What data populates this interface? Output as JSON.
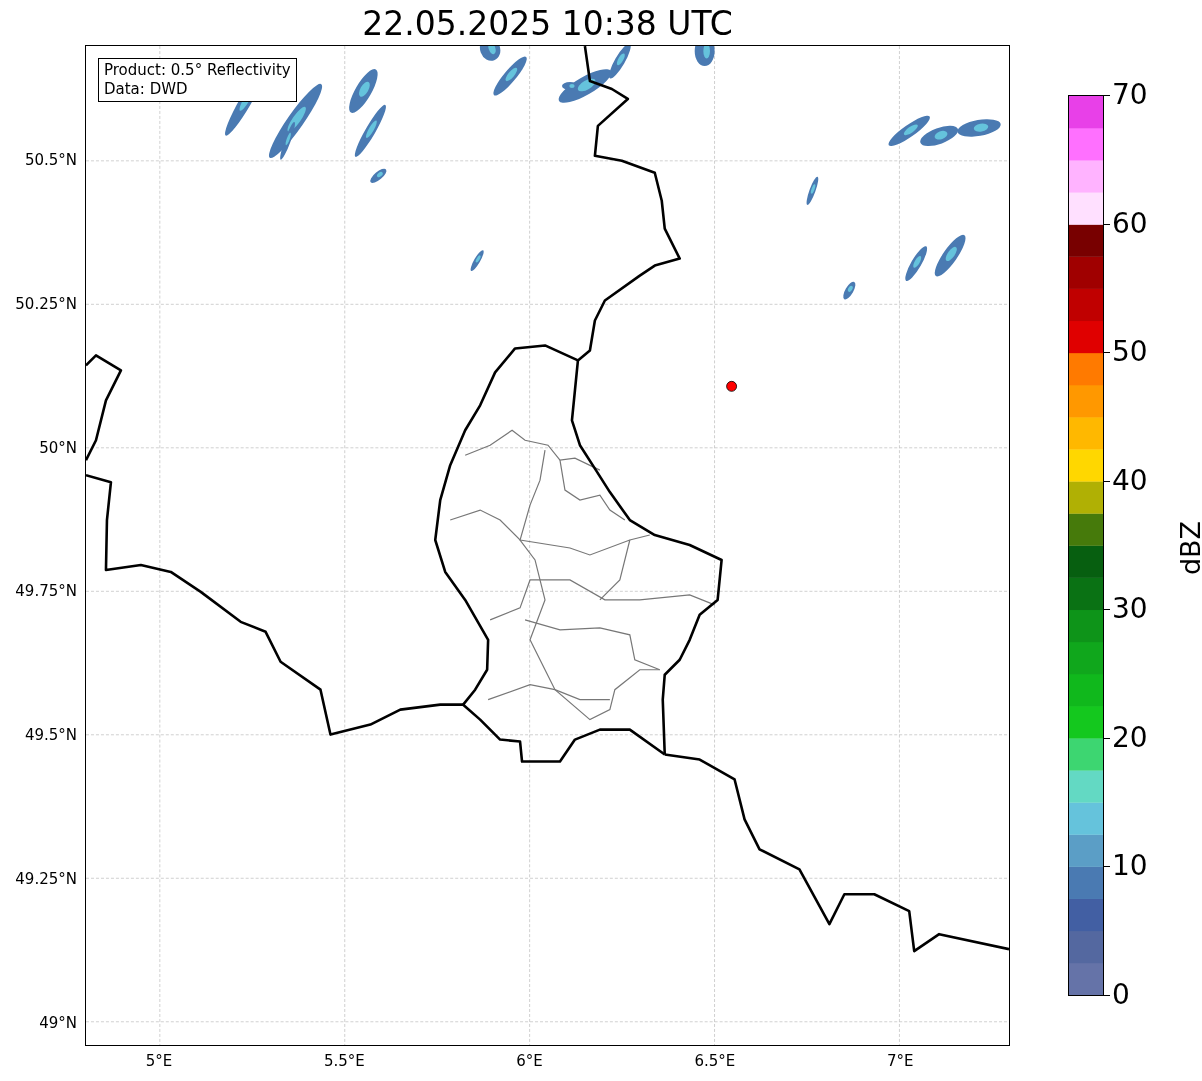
{
  "title": "22.05.2025 10:38 UTC",
  "map": {
    "info_lines": [
      "Product: 0.5° Reflectivity",
      "Data: DWD"
    ],
    "lat_ticks": [
      "50.5°N",
      "50.25°N",
      "50°N",
      "49.75°N",
      "49.5°N",
      "49.25°N",
      "49°N"
    ],
    "lon_ticks": [
      "5°E",
      "5.5°E",
      "6°E",
      "6.5°E",
      "7°E"
    ]
  },
  "colorbar": {
    "label": "dBZ",
    "ticks": [
      "70",
      "60",
      "50",
      "40",
      "30",
      "20",
      "10",
      "0"
    ],
    "bins": [
      {
        "color": "#6573a8"
      },
      {
        "color": "#5468a0"
      },
      {
        "color": "#425fa3"
      },
      {
        "color": "#4a7ab2"
      },
      {
        "color": "#5b9ec6"
      },
      {
        "color": "#65c3dc"
      },
      {
        "color": "#63d9c3"
      },
      {
        "color": "#3dd671"
      },
      {
        "color": "#14c81e"
      },
      {
        "color": "#10b81c"
      },
      {
        "color": "#10a71c"
      },
      {
        "color": "#0e9419"
      },
      {
        "color": "#0a7214"
      },
      {
        "color": "#075f10"
      },
      {
        "color": "#467a0b"
      },
      {
        "color": "#b0b004"
      },
      {
        "color": "#ffd700"
      },
      {
        "color": "#ffb800"
      },
      {
        "color": "#ff9800"
      },
      {
        "color": "#ff7a00"
      },
      {
        "color": "#e00000"
      },
      {
        "color": "#c00000"
      },
      {
        "color": "#a00000"
      },
      {
        "color": "#780000"
      },
      {
        "color": "#ffe0ff"
      },
      {
        "color": "#ffb3ff"
      },
      {
        "color": "#ff70ff"
      },
      {
        "color": "#e840e8"
      }
    ]
  }
}
